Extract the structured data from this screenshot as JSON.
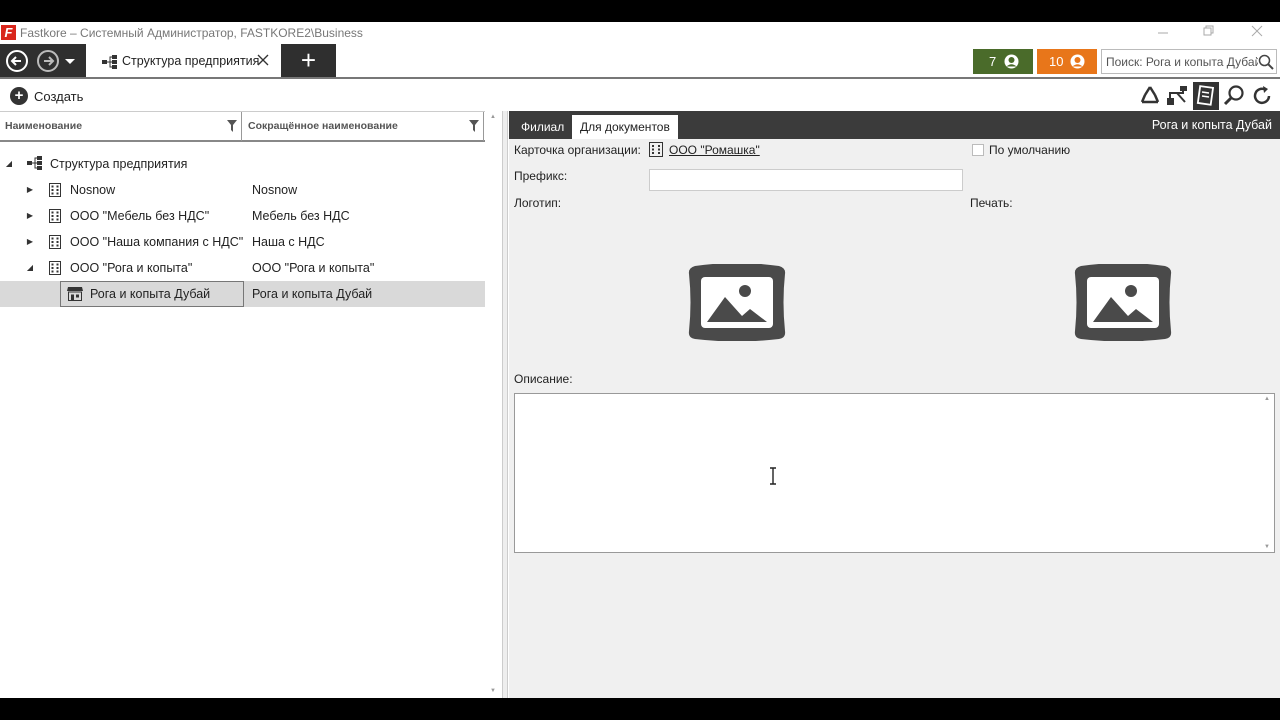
{
  "window": {
    "title": "Fastkore – Системный Администратор, FASTKORE2\\Business",
    "logo_letter": "F"
  },
  "tabs": [
    {
      "label": "Структура предприятия",
      "active": true,
      "icon": "org-tree-icon"
    }
  ],
  "tab_add_label": "+",
  "badges": {
    "badge1": {
      "count": "7",
      "color": "#4a6b2a",
      "icon": "user-icon"
    },
    "badge2": {
      "count": "10",
      "color": "#e8761a",
      "icon": "user-icon"
    }
  },
  "search": {
    "value": "Поиск: Рога и копыта Дубай"
  },
  "actions": {
    "create_label": "Создать"
  },
  "grid": {
    "columns": [
      "Наименование",
      "Сокращённое наименование"
    ],
    "root": {
      "name": "Структура предприятия",
      "icon": "org-tree-icon"
    },
    "rows": [
      {
        "name": "Nosnow",
        "short": "Nosnow",
        "icon": "building-icon",
        "expander": "collapsed",
        "selected": false
      },
      {
        "name": "ООО \"Мебель без НДС\"",
        "short": "Мебель без НДС",
        "icon": "building-icon",
        "expander": "collapsed",
        "selected": false
      },
      {
        "name": "ООО \"Наша компания с НДС\"",
        "short": "Наша с НДС",
        "icon": "building-icon",
        "expander": "collapsed",
        "selected": false
      },
      {
        "name": "ООО \"Рога и копыта\"",
        "short": "ООО \"Рога и копыта\"",
        "icon": "building-icon",
        "expander": "expanded",
        "selected": false
      },
      {
        "name": "Рога и копыта Дубай",
        "short": "Рога и копыта Дубай",
        "icon": "store-icon",
        "expander": "none",
        "selected": true
      }
    ]
  },
  "detail": {
    "tabs": [
      {
        "label": "Филиал",
        "active": false
      },
      {
        "label": "Для документов",
        "active": true
      }
    ],
    "title": "Рога и копыта Дубай",
    "org_card_label": "Карточка организации:",
    "org_card_value": "ООО \"Ромашка\"",
    "default_label": "По умолчанию",
    "default_checked": false,
    "prefix_label": "Префикс:",
    "prefix_value": "",
    "logo_label": "Логотип:",
    "stamp_label": "Печать:",
    "description_label": "Описание:",
    "description_value": ""
  },
  "colors": {
    "dark_bar": "#2f2f2f",
    "panel_header": "#3b3b3b",
    "selected_row": "#d9d9d9",
    "image_placeholder": "#4a4a4a"
  }
}
